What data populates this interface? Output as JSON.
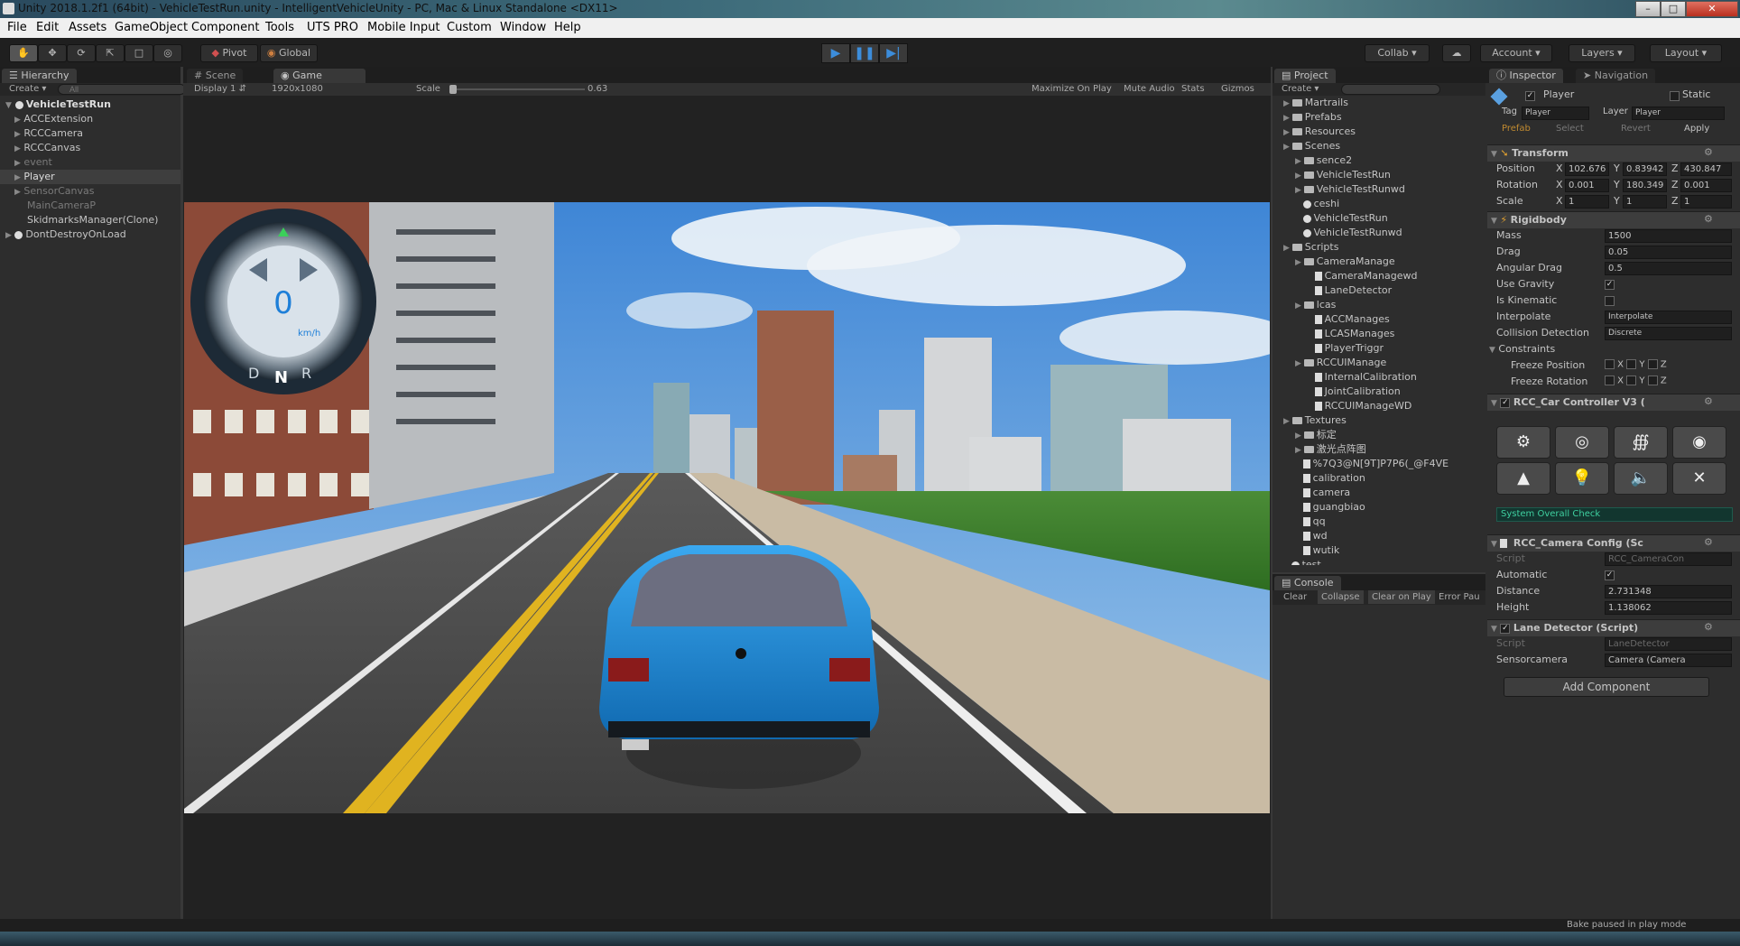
{
  "title_bar": {
    "title": "Unity 2018.1.2f1 (64bit) - VehicleTestRun.unity - IntelligentVehicleUnity - PC, Mac & Linux Standalone <DX11>"
  },
  "menu": [
    "File",
    "Edit",
    "Assets",
    "GameObject",
    "Component",
    "Tools",
    "UTS PRO",
    "Mobile Input",
    "Custom",
    "Window",
    "Help"
  ],
  "toolbar": {
    "pivot": "Pivot",
    "global": "Global",
    "collab": "Collab",
    "account": "Account",
    "layers": "Layers",
    "layout": "Layout"
  },
  "hierarchy": {
    "tab": "Hierarchy",
    "create": "Create",
    "search_placeholder": "All",
    "scene": "VehicleTestRun",
    "items": [
      "ACCExtension",
      "RCCCamera",
      "RCCCanvas",
      "event",
      "Player",
      "SensorCanvas",
      "MainCameraP",
      "SkidmarksManager(Clone)"
    ],
    "dont_destroy": "DontDestroyOnLoad"
  },
  "game_view": {
    "tab_scene": "Scene",
    "tab_game": "Game",
    "display": "Display 1",
    "resolution": "1920x1080",
    "scale_label": "Scale",
    "scale_value": "0.63",
    "maximize": "Maximize On Play",
    "mute": "Mute Audio",
    "stats": "Stats",
    "gizmos": "Gizmos",
    "speed": "0",
    "speed_unit": "km/h",
    "gears": [
      "D",
      "N",
      "R"
    ]
  },
  "project": {
    "tab": "Project",
    "create": "Create",
    "tree": [
      {
        "d": 0,
        "t": "folder",
        "n": "Martrails"
      },
      {
        "d": 0,
        "t": "folder",
        "n": "Prefabs"
      },
      {
        "d": 0,
        "t": "folder",
        "n": "Resources"
      },
      {
        "d": 0,
        "t": "folder",
        "n": "Scenes"
      },
      {
        "d": 1,
        "t": "folder",
        "n": "sence2"
      },
      {
        "d": 1,
        "t": "folder",
        "n": "VehicleTestRun"
      },
      {
        "d": 1,
        "t": "folder",
        "n": "VehicleTestRunwd"
      },
      {
        "d": 1,
        "t": "unity",
        "n": "ceshi"
      },
      {
        "d": 1,
        "t": "unity",
        "n": "VehicleTestRun"
      },
      {
        "d": 1,
        "t": "unity",
        "n": "VehicleTestRunwd"
      },
      {
        "d": 0,
        "t": "folder",
        "n": "Scripts"
      },
      {
        "d": 1,
        "t": "folder",
        "n": "CameraManage"
      },
      {
        "d": 2,
        "t": "file",
        "n": "CameraManagewd"
      },
      {
        "d": 2,
        "t": "file",
        "n": "LaneDetector"
      },
      {
        "d": 1,
        "t": "folder",
        "n": "lcas"
      },
      {
        "d": 2,
        "t": "file",
        "n": "ACCManages"
      },
      {
        "d": 2,
        "t": "file",
        "n": "LCASManages"
      },
      {
        "d": 2,
        "t": "file",
        "n": "PlayerTriggr"
      },
      {
        "d": 1,
        "t": "folder",
        "n": "RCCUIManage"
      },
      {
        "d": 2,
        "t": "file",
        "n": "InternalCalibration"
      },
      {
        "d": 2,
        "t": "file",
        "n": "JointCalibration"
      },
      {
        "d": 2,
        "t": "file",
        "n": "RCCUIManageWD"
      },
      {
        "d": 0,
        "t": "folder",
        "n": "Textures"
      },
      {
        "d": 1,
        "t": "folder",
        "n": "标定"
      },
      {
        "d": 1,
        "t": "folder",
        "n": "激光点阵图"
      },
      {
        "d": 1,
        "t": "file",
        "n": "%7Q3@N[9T]P7P6(_@F4VE"
      },
      {
        "d": 1,
        "t": "file",
        "n": "calibration"
      },
      {
        "d": 1,
        "t": "file",
        "n": "camera"
      },
      {
        "d": 1,
        "t": "file",
        "n": "guangbiao"
      },
      {
        "d": 1,
        "t": "file",
        "n": "qq"
      },
      {
        "d": 1,
        "t": "file",
        "n": "wd"
      },
      {
        "d": 1,
        "t": "file",
        "n": "wutik"
      },
      {
        "d": 0,
        "t": "unity",
        "n": "test"
      }
    ]
  },
  "console": {
    "tab": "Console",
    "buttons": [
      "Clear",
      "Collapse",
      "Clear on Play",
      "Error Pau"
    ]
  },
  "inspector": {
    "tab_inspector": "Inspector",
    "tab_navigation": "Navigation",
    "object_name": "Player",
    "static_label": "Static",
    "tag_label": "Tag",
    "tag": "Player",
    "layer_label": "Layer",
    "layer": "Player",
    "prefab_label": "Prefab",
    "select": "Select",
    "revert": "Revert",
    "apply": "Apply",
    "transform": {
      "title": "Transform",
      "position": {
        "label": "Position",
        "x": "102.676",
        "y": "0.83942",
        "z": "430.847"
      },
      "rotation": {
        "label": "Rotation",
        "x": "0.001",
        "y": "180.349",
        "z": "0.001"
      },
      "scale": {
        "label": "Scale",
        "x": "1",
        "y": "1",
        "z": "1"
      }
    },
    "rigidbody": {
      "title": "Rigidbody",
      "mass_label": "Mass",
      "mass": "1500",
      "drag_label": "Drag",
      "drag": "0.05",
      "angular_drag_label": "Angular Drag",
      "angular_drag": "0.5",
      "use_gravity_label": "Use Gravity",
      "is_kinematic_label": "Is Kinematic",
      "interpolate_label": "Interpolate",
      "interpolate": "Interpolate",
      "collision_label": "Collision Detection",
      "collision": "Discrete",
      "constraints_label": "Constraints",
      "freeze_pos_label": "Freeze Position",
      "freeze_rot_label": "Freeze Rotation"
    },
    "car_controller": {
      "title": "RCC_Car Controller V3 (",
      "system_check": "System Overall Check"
    },
    "camera_config": {
      "title": "RCC_Camera Config (Sc",
      "script_label": "Script",
      "script": "RCC_CameraCon",
      "automatic_label": "Automatic",
      "distance_label": "Distance",
      "distance": "2.731348",
      "height_label": "Height",
      "height": "1.138062"
    },
    "lane_detector": {
      "title": "Lane Detector (Script)",
      "script_label": "Script",
      "script": "LaneDetector",
      "sensorcamera_label": "Sensorcamera",
      "sensorcamera": "Camera (Camera"
    },
    "add_component": "Add Component"
  },
  "status_bar": {
    "text": "Bake paused in play mode"
  },
  "colors": {
    "accent": "#3c8ddb",
    "panel": "#2d2d2d",
    "toolbar": "#1f1f1f",
    "sky": "#5aa0e0",
    "grass": "#3f8a2e",
    "road": "#4a4a4a",
    "car": "#1e8fd8"
  }
}
